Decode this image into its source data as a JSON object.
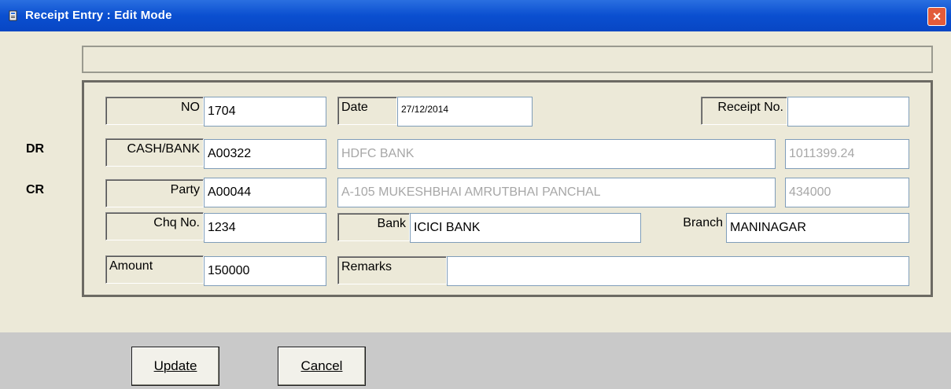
{
  "window": {
    "title": "Receipt Entry : Edit Mode",
    "close_label": "×"
  },
  "side_labels": {
    "dr": "DR",
    "cr": "CR"
  },
  "row_no": {
    "no_label": "NO",
    "no_value": "1704",
    "date_label": "Date",
    "date_value": "27/12/2014",
    "receipt_label": "Receipt No.",
    "receipt_value": ""
  },
  "row_cash": {
    "label": "CASH/BANK",
    "code": "A00322",
    "name": "HDFC BANK",
    "balance": "1011399.24"
  },
  "row_party": {
    "label": "Party",
    "code": "A00044",
    "name": "A-105 MUKESHBHAI AMRUTBHAI PANCHAL",
    "balance": "434000"
  },
  "row_chq": {
    "chq_label": "Chq No.",
    "chq_value": "1234",
    "bank_label": "Bank",
    "bank_value": "ICICI BANK",
    "branch_label": "Branch",
    "branch_value": "MANINAGAR"
  },
  "row_amount": {
    "amount_label": "Amount",
    "amount_value": "150000",
    "remarks_label": "Remarks",
    "remarks_value": ""
  },
  "buttons": {
    "update_label": "Update",
    "cancel_label": "Cancel"
  },
  "colors": {
    "titlebar": "#0a4fd0",
    "background": "#ece9d8",
    "footer": "#c9c9c9",
    "disabled_text": "#a7a7a7"
  }
}
